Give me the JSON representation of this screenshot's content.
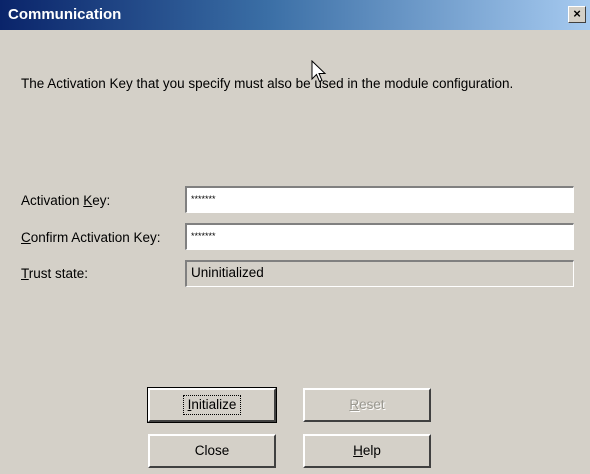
{
  "window": {
    "title": "Communication",
    "close_glyph": "×"
  },
  "info_text": "The Activation Key that you specify must also be used in the module configuration.",
  "fields": {
    "activation_key": {
      "label_pre": "Activation ",
      "label_ul": "K",
      "label_post": "ey:",
      "value": "*******"
    },
    "confirm_key": {
      "label_pre": "",
      "label_ul": "C",
      "label_post": "onfirm Activation Key:",
      "value": "*******"
    },
    "trust_state": {
      "label_pre": "",
      "label_ul": "T",
      "label_post": "rust state:",
      "value": "Uninitialized"
    }
  },
  "buttons": {
    "initialize": {
      "ul": "I",
      "rest": "nitialize"
    },
    "reset": {
      "ul": "R",
      "rest": "eset"
    },
    "close": {
      "label": "Close"
    },
    "help": {
      "ul": "H",
      "rest": "elp"
    }
  },
  "icons": {
    "cursor": "mouse-pointer-icon"
  }
}
